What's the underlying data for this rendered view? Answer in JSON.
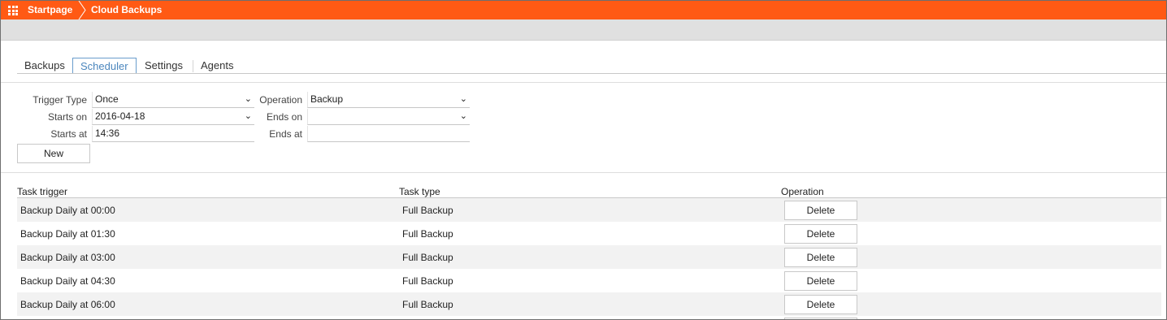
{
  "breadcrumb": {
    "home": "Startpage",
    "current": "Cloud Backups"
  },
  "tabs": [
    "Backups",
    "Scheduler",
    "Settings",
    "Agents"
  ],
  "active_tab": "Scheduler",
  "form": {
    "trigger_type_label": "Trigger Type",
    "trigger_type_value": "Once",
    "starts_on_label": "Starts on",
    "starts_on_value": "2016-04-18",
    "starts_at_label": "Starts at",
    "starts_at_value": "14:36",
    "operation_label": "Operation",
    "operation_value": "Backup",
    "ends_on_label": "Ends on",
    "ends_on_value": "",
    "ends_at_label": "Ends at",
    "ends_at_value": "",
    "new_button": "New"
  },
  "table": {
    "headers": [
      "Task trigger",
      "Task type",
      "Operation"
    ],
    "rows": [
      {
        "trigger": "Backup Daily at 00:00",
        "type": "Full Backup",
        "action": "Delete"
      },
      {
        "trigger": "Backup Daily at 01:30",
        "type": "Full Backup",
        "action": "Delete"
      },
      {
        "trigger": "Backup Daily at 03:00",
        "type": "Full Backup",
        "action": "Delete"
      },
      {
        "trigger": "Backup Daily at 04:30",
        "type": "Full Backup",
        "action": "Delete"
      },
      {
        "trigger": "Backup Daily at 06:00",
        "type": "Full Backup",
        "action": "Delete"
      }
    ]
  },
  "colors": {
    "topbar": "#ff5a14",
    "active_tab": "#4b86bd",
    "row_alt": "#f2f2f2"
  },
  "icons": {
    "apps": "grid-apps-icon",
    "dropdown": "chevron-down-icon"
  }
}
